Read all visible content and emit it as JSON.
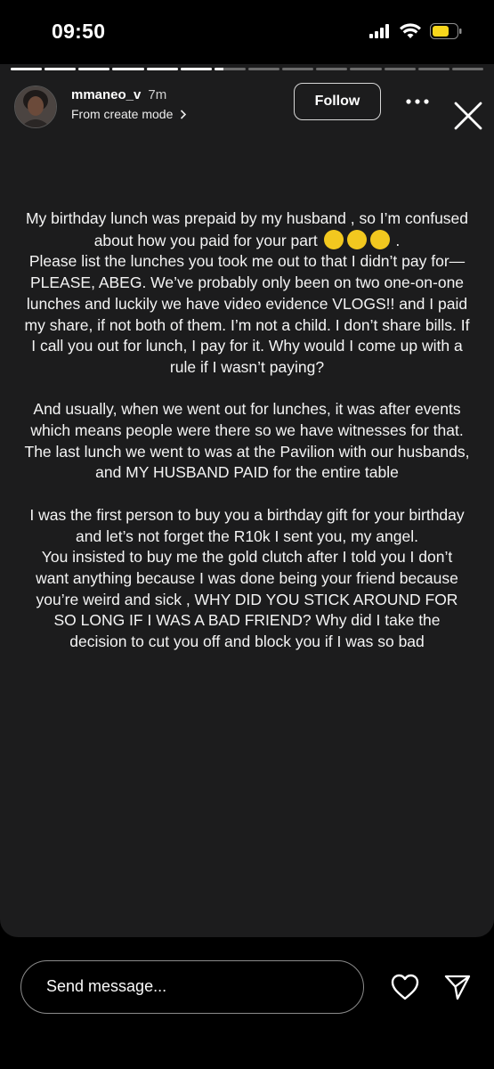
{
  "status_bar": {
    "time": "09:50",
    "icons": [
      "cellular-signal-icon",
      "wifi-icon",
      "battery-low-icon"
    ],
    "battery_color": "#f9d71c"
  },
  "story": {
    "progress_segments": [
      1,
      1,
      1,
      1,
      1,
      1,
      0.3,
      0,
      0,
      0,
      0,
      0,
      0,
      0
    ],
    "header": {
      "username": "mmaneo_v",
      "age": "7m",
      "subtitle": "From create mode",
      "follow_label": "Follow",
      "more_icon": "more-horizontal-icon",
      "close_icon": "close-icon"
    },
    "paragraphs": [
      {
        "before_emoji": "My birthday lunch was prepaid by my husband , so I’m confused about how you paid for your part",
        "emoji_count": 3,
        "after_emoji": " .\nPlease list the lunches you took me out to that I didn’t pay for— PLEASE, ABEG. We’ve probably only been on two one-on-one lunches and luckily we have video evidence VLOGS!! and I paid my share, if not both of them. I’m not a child. I don’t share bills. If I call you out for lunch, I pay for it. Why would I come up with a rule if I wasn’t paying?"
      },
      {
        "text": "And usually, when we went out for lunches, it was after events which means people were there so we have witnesses for that. The last lunch we went to was at the Pavilion with our husbands, and MY HUSBAND PAID for the entire table"
      },
      {
        "text": "I was the first person to buy you a birthday gift for your birthday and let’s not forget the R10k I sent you, my angel.\nYou insisted to buy me the gold clutch after I told you I don’t want anything because I was done being your friend because you’re weird and sick , WHY DID YOU STICK AROUND FOR SO LONG IF I WAS A BAD FRIEND? Why did I take the decision to cut you off and block you if I was so bad"
      }
    ],
    "background_color": "#1c1c1d"
  },
  "reply_bar": {
    "placeholder": "Send message...",
    "like_icon": "heart-icon",
    "share_icon": "send-icon"
  }
}
